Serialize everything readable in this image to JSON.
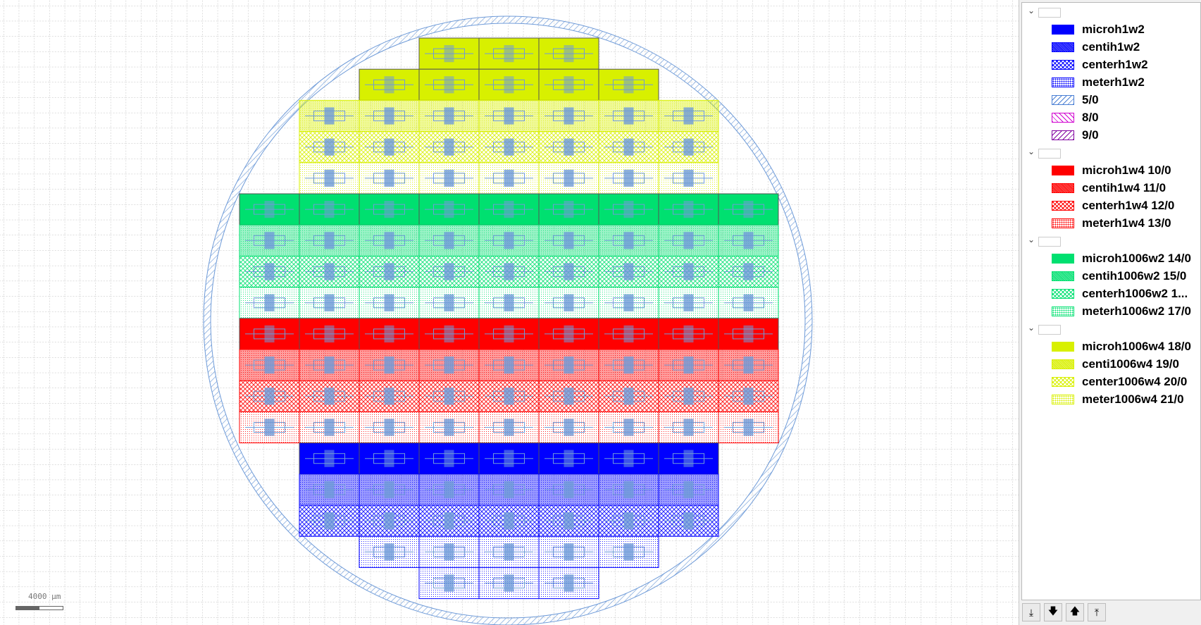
{
  "scale_label": "4000 µm",
  "layers": [
    {
      "kind": "group",
      "expanded": true
    },
    {
      "kind": "layer",
      "name": "microh1w2",
      "color": "#0000ff",
      "fill": "solid"
    },
    {
      "kind": "layer",
      "name": "centih1w2",
      "color": "#0000ff",
      "fill": "dense"
    },
    {
      "kind": "layer",
      "name": "centerh1w2",
      "color": "#0000ff",
      "fill": "cross"
    },
    {
      "kind": "layer",
      "name": "meterh1w2",
      "color": "#0000ff",
      "fill": "dots"
    },
    {
      "kind": "layer",
      "name": "5/0",
      "color": "#4a7fd4",
      "fill": "hatch"
    },
    {
      "kind": "layer",
      "name": "8/0",
      "color": "#d000d0",
      "fill": "hatchb"
    },
    {
      "kind": "layer",
      "name": "9/0",
      "color": "#8000a0",
      "fill": "hatch"
    },
    {
      "kind": "group",
      "expanded": true
    },
    {
      "kind": "layer",
      "name": "microh1w4 10/0",
      "color": "#ff0000",
      "fill": "solid"
    },
    {
      "kind": "layer",
      "name": "centih1w4 11/0",
      "color": "#ff0000",
      "fill": "dense"
    },
    {
      "kind": "layer",
      "name": "centerh1w4 12/0",
      "color": "#ff0000",
      "fill": "cross"
    },
    {
      "kind": "layer",
      "name": "meterh1w4 13/0",
      "color": "#ff0000",
      "fill": "dots"
    },
    {
      "kind": "group",
      "expanded": true
    },
    {
      "kind": "layer",
      "name": "microh1006w2 14/0",
      "color": "#00e070",
      "fill": "solid"
    },
    {
      "kind": "layer",
      "name": "centih1006w2 15/0",
      "color": "#00e070",
      "fill": "dense"
    },
    {
      "kind": "layer",
      "name": "centerh1006w2 1...",
      "color": "#00e070",
      "fill": "cross"
    },
    {
      "kind": "layer",
      "name": "meterh1006w2 17/0",
      "color": "#00e070",
      "fill": "dots"
    },
    {
      "kind": "group",
      "expanded": true
    },
    {
      "kind": "layer",
      "name": "microh1006w4 18/0",
      "color": "#d8f000",
      "fill": "solid"
    },
    {
      "kind": "layer",
      "name": "centi1006w4 19/0",
      "color": "#d8f000",
      "fill": "dense"
    },
    {
      "kind": "layer",
      "name": "center1006w4 20/0",
      "color": "#d8f000",
      "fill": "cross"
    },
    {
      "kind": "layer",
      "name": "meter1006w4 21/0",
      "color": "#d8f000",
      "fill": "dots"
    }
  ],
  "toolbar": [
    {
      "name": "move-to-bottom-button",
      "glyph": "⤓"
    },
    {
      "name": "move-down-button",
      "glyph": "🡇"
    },
    {
      "name": "move-up-button",
      "glyph": "🡅"
    },
    {
      "name": "move-to-top-button",
      "glyph": "⤒"
    }
  ],
  "wafer_rows": [
    {
      "cols": [
        3,
        5
      ],
      "color": "#d8f000",
      "fill": "solid"
    },
    {
      "cols": [
        2,
        6
      ],
      "color": "#d8f000",
      "fill": "solid"
    },
    {
      "cols": [
        1,
        7
      ],
      "color": "#d8f000",
      "fill": "dense"
    },
    {
      "cols": [
        1,
        7
      ],
      "color": "#d8f000",
      "fill": "cross"
    },
    {
      "cols": [
        1,
        7
      ],
      "color": "#d8f000",
      "fill": "dots"
    },
    {
      "cols": [
        0,
        8
      ],
      "color": "#00e070",
      "fill": "solid"
    },
    {
      "cols": [
        0,
        8
      ],
      "color": "#00e070",
      "fill": "dense"
    },
    {
      "cols": [
        0,
        8
      ],
      "color": "#00e070",
      "fill": "cross"
    },
    {
      "cols": [
        0,
        8
      ],
      "color": "#00e070",
      "fill": "dots"
    },
    {
      "cols": [
        0,
        8
      ],
      "color": "#ff0000",
      "fill": "solid"
    },
    {
      "cols": [
        0,
        8
      ],
      "color": "#ff0000",
      "fill": "dense"
    },
    {
      "cols": [
        0,
        8
      ],
      "color": "#ff0000",
      "fill": "cross"
    },
    {
      "cols": [
        0,
        8
      ],
      "color": "#ff0000",
      "fill": "dots"
    },
    {
      "cols": [
        1,
        7
      ],
      "color": "#0000ff",
      "fill": "solid"
    },
    {
      "cols": [
        1,
        7
      ],
      "color": "#0000ff",
      "fill": "dense"
    },
    {
      "cols": [
        1,
        7
      ],
      "color": "#0000ff",
      "fill": "cross"
    },
    {
      "cols": [
        2,
        6
      ],
      "color": "#0000ff",
      "fill": "dots"
    },
    {
      "cols": [
        3,
        5
      ],
      "color": "#0000ff",
      "fill": "dots"
    }
  ]
}
